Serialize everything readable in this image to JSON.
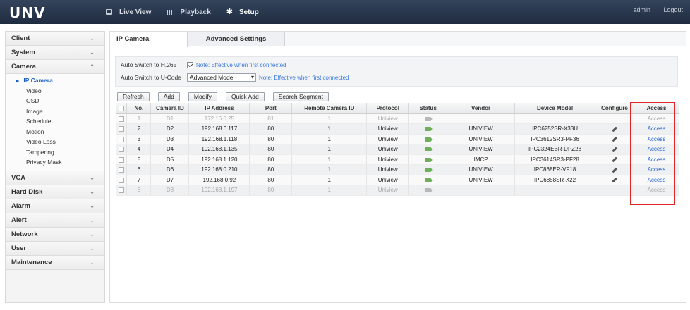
{
  "topbar": {
    "logo": "UNV",
    "nav": [
      {
        "label": "Live View",
        "icon": "monitor-icon"
      },
      {
        "label": "Playback",
        "icon": "film-icon"
      },
      {
        "label": "Setup",
        "icon": "gear-icon"
      }
    ],
    "user": "admin",
    "logout": "Logout"
  },
  "sidebar": {
    "client": "Client",
    "system": "System",
    "camera": "Camera",
    "camera_items": [
      "IP Camera",
      "Video",
      "OSD",
      "Image",
      "Schedule",
      "Motion",
      "Video Loss",
      "Tampering",
      "Privacy Mask"
    ],
    "vca": "VCA",
    "hard_disk": "Hard Disk",
    "alarm": "Alarm",
    "alert": "Alert",
    "network": "Network",
    "user": "User",
    "maintenance": "Maintenance"
  },
  "tabs": {
    "ip_camera": "IP Camera",
    "advanced": "Advanced Settings"
  },
  "settings": {
    "h265_label": "Auto Switch to H.265",
    "h265_note": "Note: Effective when first connected",
    "ucode_label": "Auto Switch to U-Code",
    "ucode_value": "Advanced Mode",
    "ucode_note": "Note: Effective when first connected"
  },
  "buttons": {
    "refresh": "Refresh",
    "add": "Add",
    "modify": "Modify",
    "quick_add": "Quick Add",
    "search_segment": "Search Segment"
  },
  "table": {
    "headers": {
      "no": "No.",
      "camera_id": "Camera ID",
      "ip": "IP Address",
      "port": "Port",
      "remote_id": "Remote Camera ID",
      "protocol": "Protocol",
      "status": "Status",
      "vendor": "Vendor",
      "model": "Device Model",
      "configure": "Configure",
      "access": "Access"
    },
    "rows": [
      {
        "no": "1",
        "camera_id": "D1",
        "ip": "172.16.0.25",
        "port": "81",
        "remote_id": "1",
        "protocol": "Uniview",
        "vendor": "",
        "model": "",
        "access": "Access"
      },
      {
        "no": "2",
        "camera_id": "D2",
        "ip": "192.168.0.117",
        "port": "80",
        "remote_id": "1",
        "protocol": "Uniview",
        "vendor": "UNIVIEW",
        "model": "IPC6252SR-X33U",
        "access": "Access"
      },
      {
        "no": "3",
        "camera_id": "D3",
        "ip": "192.168.1.118",
        "port": "80",
        "remote_id": "1",
        "protocol": "Uniview",
        "vendor": "UNIVIEW",
        "model": "IPC3612SR3-PF36",
        "access": "Access"
      },
      {
        "no": "4",
        "camera_id": "D4",
        "ip": "192.168.1.135",
        "port": "80",
        "remote_id": "1",
        "protocol": "Uniview",
        "vendor": "UNIVIEW",
        "model": "IPC2324EBR-DPZ28",
        "access": "Access"
      },
      {
        "no": "5",
        "camera_id": "D5",
        "ip": "192.168.1.120",
        "port": "80",
        "remote_id": "1",
        "protocol": "Uniview",
        "vendor": "IMCP",
        "model": "IPC3614SR3-PF28",
        "access": "Access"
      },
      {
        "no": "6",
        "camera_id": "D6",
        "ip": "192.168.0.210",
        "port": "80",
        "remote_id": "1",
        "protocol": "Uniview",
        "vendor": "UNIVIEW",
        "model": "IPC868ER-VF18",
        "access": "Access"
      },
      {
        "no": "7",
        "camera_id": "D7",
        "ip": "192.168.0.92",
        "port": "80",
        "remote_id": "1",
        "protocol": "Uniview",
        "vendor": "UNIVIEW",
        "model": "IPC6858SR-X22",
        "access": "Access"
      },
      {
        "no": "8",
        "camera_id": "D8",
        "ip": "192.168.1.197",
        "port": "80",
        "remote_id": "1",
        "protocol": "Uniview",
        "vendor": "",
        "model": "",
        "access": "Access"
      }
    ]
  },
  "colors": {
    "accent": "#1a5fc6",
    "highlight": "#e02626",
    "online": "#6fae5a",
    "offline": "#b8b8b8"
  }
}
